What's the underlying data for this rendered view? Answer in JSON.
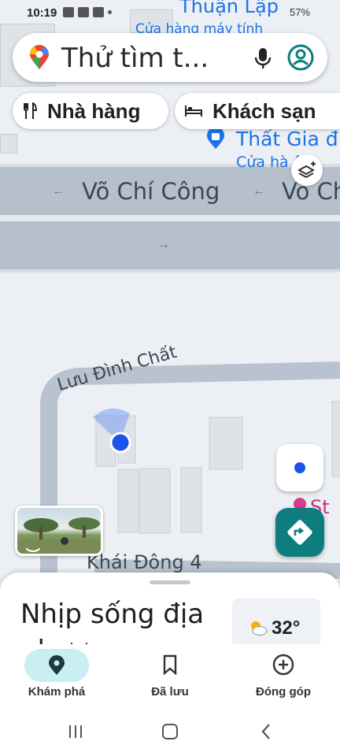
{
  "status_bar": {
    "time": "10:19",
    "right_text": "57%"
  },
  "search": {
    "placeholder": "Thử tìm t..."
  },
  "chips": [
    {
      "label": "Nhà hàng",
      "icon": "restaurant-icon"
    },
    {
      "label": "Khách sạn",
      "icon": "hotel-icon"
    }
  ],
  "map": {
    "poi_top": {
      "name": "Thuận Lập",
      "category": "Cửa hàng máy tính"
    },
    "poi_mid": {
      "name": "Thất Gia đ",
      "category": "Cửa hà  ội"
    },
    "poi_right": {
      "name": "St"
    },
    "streets": {
      "main_a": "Võ Chí Công",
      "main_b": "Võ Ch",
      "curve": "Lưu Đình Chất",
      "bottom": "Khái Đông 4"
    }
  },
  "sheet": {
    "title": "Nhịp sống địa phương",
    "weather_temp": "32°"
  },
  "bottom_nav": [
    {
      "label": "Khám phá",
      "icon": "explore-pin-icon",
      "active": true
    },
    {
      "label": "Đã lưu",
      "icon": "bookmark-icon",
      "active": false
    },
    {
      "label": "Đóng góp",
      "icon": "add-circle-icon",
      "active": false
    }
  ],
  "colors": {
    "accent_teal": "#0d7d80",
    "poi_blue": "#1a73e8",
    "location_dot": "#1a55e8",
    "active_pill": "#c9eef3"
  }
}
